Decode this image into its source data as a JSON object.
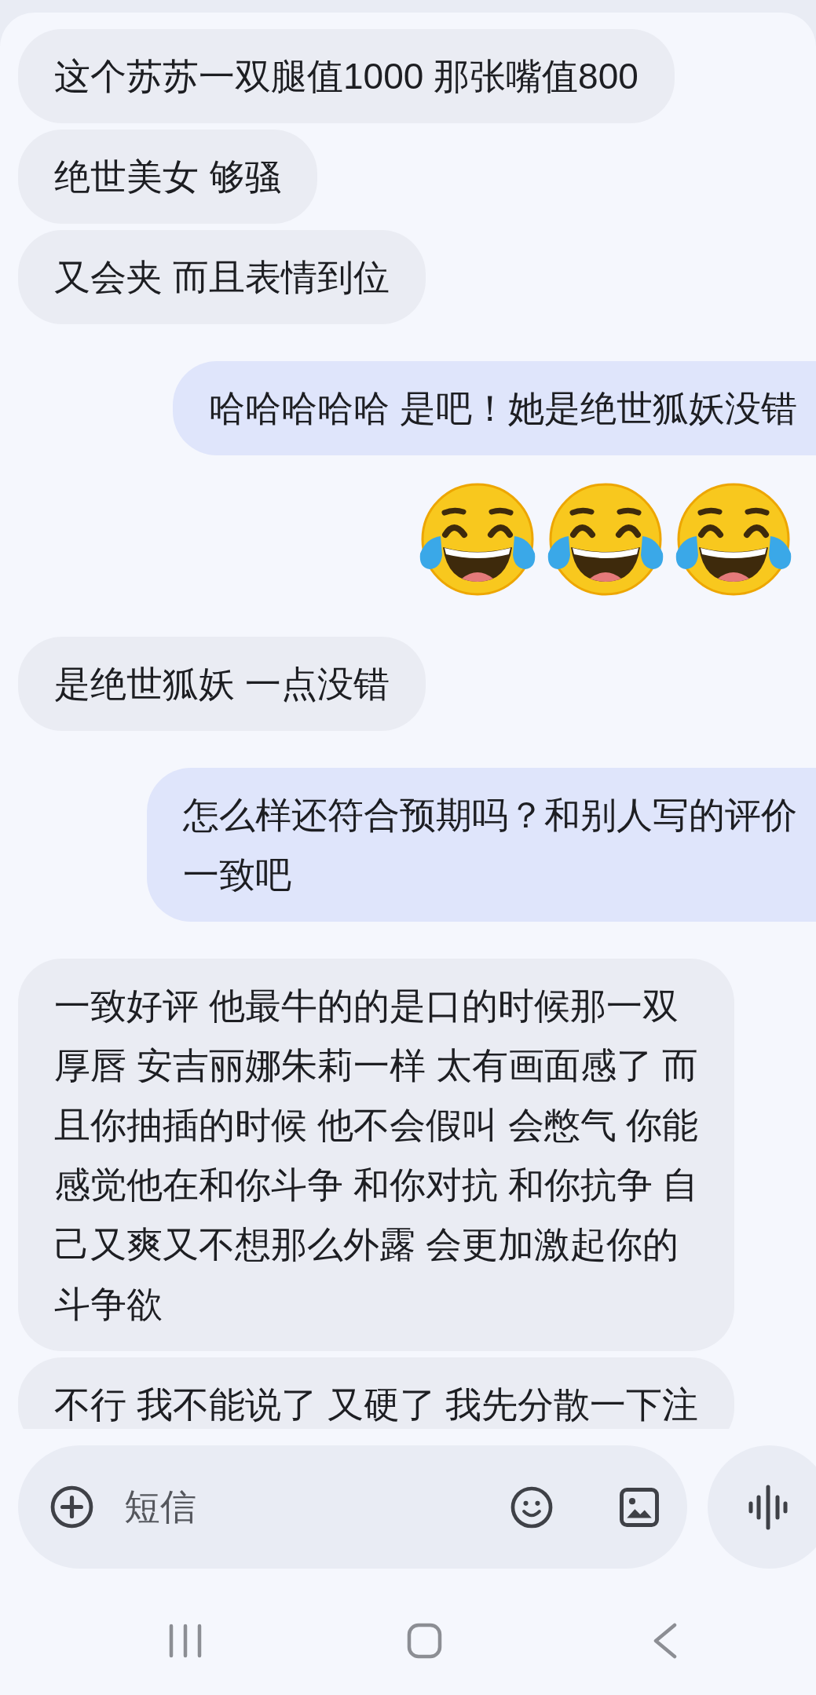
{
  "messages": [
    {
      "kind": "text",
      "outgoing": false,
      "lines": [
        "这个苏苏一双腿值1000 那张嘴值800"
      ]
    },
    {
      "kind": "text",
      "outgoing": false,
      "lines": [
        "绝世美女 够骚"
      ]
    },
    {
      "kind": "text",
      "outgoing": false,
      "lines": [
        "又会夹 而且表情到位"
      ]
    },
    {
      "kind": "text",
      "outgoing": true,
      "lines": [
        "哈哈哈哈哈 是吧！她是绝世狐妖没错"
      ]
    },
    {
      "kind": "emoji",
      "outgoing": true,
      "emojis": [
        {
          "kind": "tears-of-joy"
        },
        {
          "kind": "tears-of-joy"
        },
        {
          "kind": "tears-of-joy"
        }
      ]
    },
    {
      "kind": "text",
      "outgoing": false,
      "lines": [
        "是绝世狐妖 一点没错"
      ]
    },
    {
      "kind": "text",
      "outgoing": true,
      "lines": [
        "怎么样还符合预期吗？和别人写的评价",
        "一致吧"
      ]
    },
    {
      "kind": "text",
      "outgoing": false,
      "lines": [
        "一致好评 他最牛的的是口的时候那一双",
        "厚唇 安吉丽娜朱莉一样 太有画面感了 而",
        "且你抽插的时候 他不会假叫 会憋气 你能",
        "感觉他在和你斗争 和你对抗 和你抗争 自",
        "己又爽又不想那么外露 会更加激起你的",
        "斗争欲"
      ]
    },
    {
      "kind": "text",
      "outgoing": false,
      "lines": [
        "不行 我不能说了 又硬了 我先分散一下注"
      ]
    }
  ],
  "composer": {
    "placeholder": "短信"
  }
}
